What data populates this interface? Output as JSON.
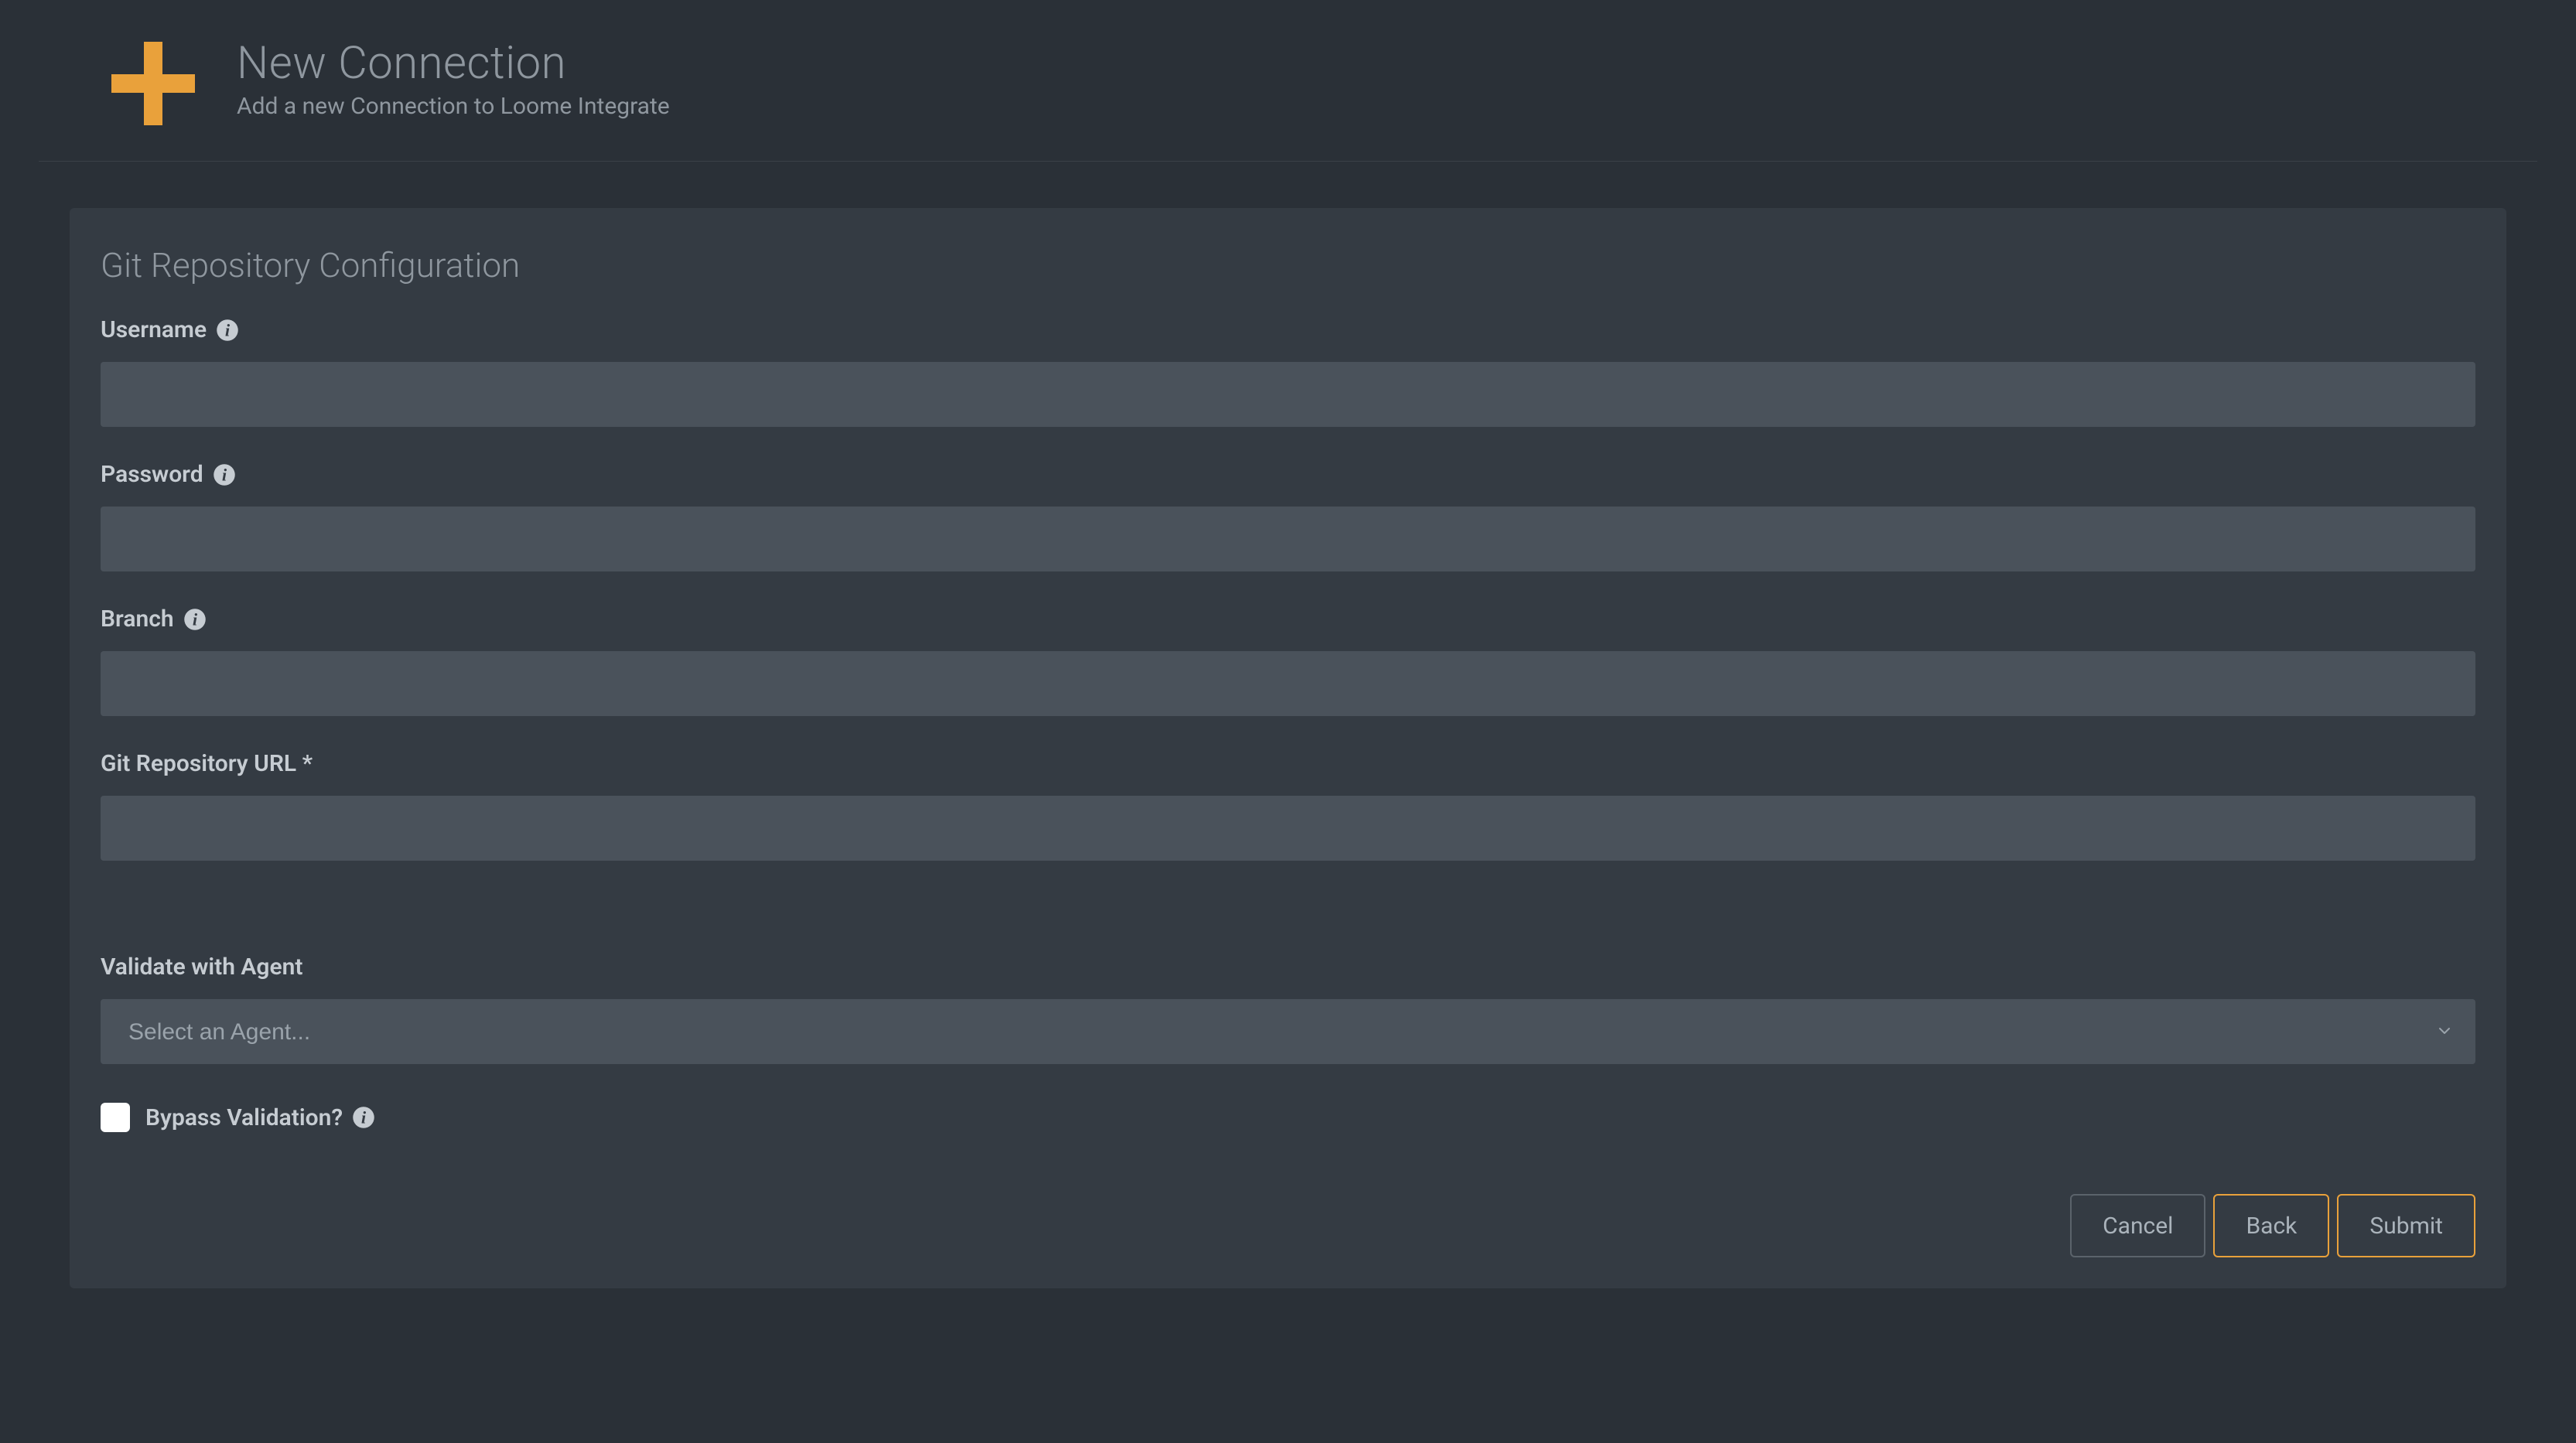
{
  "header": {
    "title": "New Connection",
    "subtitle": "Add a new Connection to Loome Integrate"
  },
  "panel": {
    "title": "Git Repository Configuration",
    "fields": {
      "username": {
        "label": "Username",
        "value": ""
      },
      "password": {
        "label": "Password",
        "value": ""
      },
      "branch": {
        "label": "Branch",
        "value": ""
      },
      "repo_url": {
        "label": "Git Repository URL *",
        "value": ""
      }
    },
    "validate": {
      "label": "Validate with Agent",
      "placeholder": "Select an Agent..."
    },
    "bypass": {
      "label": "Bypass Validation?",
      "checked": false
    },
    "buttons": {
      "cancel": "Cancel",
      "back": "Back",
      "submit": "Submit"
    }
  }
}
